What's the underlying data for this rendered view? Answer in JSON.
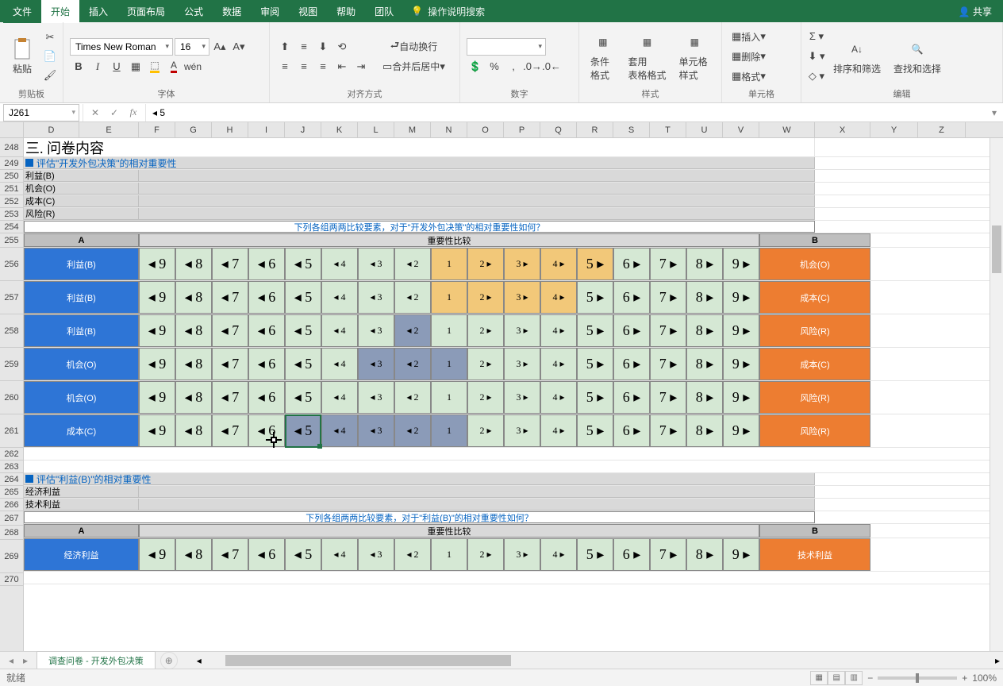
{
  "menus": {
    "file": "文件",
    "home": "开始",
    "insert": "插入",
    "layout": "页面布局",
    "formulas": "公式",
    "data": "数据",
    "review": "审阅",
    "view": "视图",
    "help": "帮助",
    "team": "团队",
    "tellme": "操作说明搜索",
    "share": "共享"
  },
  "ribbon": {
    "clipboard": "剪贴板",
    "paste": "粘贴",
    "font": "字体",
    "font_name": "Times New Roman",
    "font_size": "16",
    "alignment": "对齐方式",
    "wrap": "自动换行",
    "merge": "合并后居中",
    "number": "数字",
    "styles": "样式",
    "cond": "条件格式",
    "tbl": "套用\n表格格式",
    "cellstyle": "单元格样式",
    "cells": "单元格",
    "ins": "插入",
    "del": "删除",
    "fmt": "格式",
    "editing": "编辑",
    "sort": "排序和筛选",
    "find": "查找和选择"
  },
  "namebox": "J261",
  "formula": "◂ 5",
  "cols": [
    "D",
    "E",
    "F",
    "G",
    "H",
    "I",
    "J",
    "K",
    "L",
    "M",
    "N",
    "O",
    "P",
    "Q",
    "R",
    "S",
    "T",
    "U",
    "V",
    "W",
    "X",
    "Y",
    "Z"
  ],
  "row_nums": [
    "248",
    "249",
    "250",
    "251",
    "252",
    "253",
    "254",
    "255",
    "256",
    "257",
    "258",
    "259",
    "260",
    "261",
    "262",
    "263",
    "264",
    "265",
    "266",
    "267",
    "268",
    "269",
    "270"
  ],
  "content": {
    "section": "三. 问卷内容",
    "eval1": "评估\"开发外包决策\"的相对重要性",
    "cat_b": "利益(B)",
    "cat_o": "机会(O)",
    "cat_c": "成本(C)",
    "cat_r": "风险(R)",
    "q1": "下列各组两两比较要素，对于\"开发外包决策\"的相对重要性如何？",
    "hdr_a": "A",
    "hdr_b": "B",
    "hdr_imp": "重要性比较",
    "eval2": "评估\"利益(B)\"的相对重要性",
    "econ": "经济利益",
    "tech": "技术利益",
    "q2": "下列各组两两比较要素，对于\"利益(B)\"的相对重要性如何？"
  },
  "scale_left": [
    "◂ 9",
    "◂ 8",
    "◂ 7",
    "◂ 6",
    "◂ 5",
    "◂ 4",
    "◂ 3",
    "◂ 2"
  ],
  "scale_mid": [
    "1",
    "2 ▸",
    "3 ▸",
    "4 ▸"
  ],
  "scale_right": [
    "5 ▸",
    "6 ▸",
    "7 ▸",
    "8 ▸",
    "9 ▸"
  ],
  "rows_matrix": [
    {
      "left": "利益(B)",
      "right": "机会(O)",
      "mid_style": "mid",
      "mid_extra": [
        4,
        5,
        6,
        7,
        8
      ]
    },
    {
      "left": "利益(B)",
      "right": "成本(C)",
      "mid_style": "mid",
      "mid_extra": [
        4,
        5,
        6,
        7
      ]
    },
    {
      "left": "利益(B)",
      "right": "风险(R)",
      "mid_style": "",
      "sel": [
        3
      ]
    },
    {
      "left": "机会(O)",
      "right": "成本(C)",
      "mid_style": "",
      "sel": [
        2,
        3,
        4
      ]
    },
    {
      "left": "机会(O)",
      "right": "风险(R)",
      "mid_style": "",
      "sel": []
    },
    {
      "left": "成本(C)",
      "right": "风险(R)",
      "mid_style": "",
      "sel": [
        0,
        1,
        2,
        3,
        4
      ]
    }
  ],
  "row2": {
    "left": "经济利益",
    "right": "技术利益"
  },
  "sheet_tab": "调查问卷 - 开发外包决策",
  "status": {
    "ready": "就绪",
    "zoom": "100%"
  }
}
